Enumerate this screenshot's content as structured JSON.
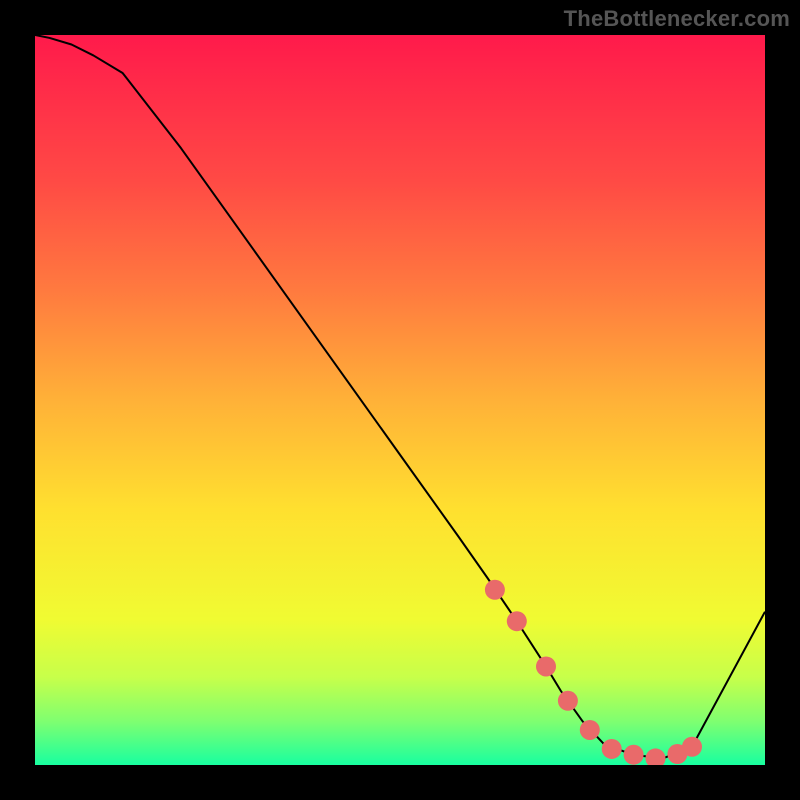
{
  "attribution": "TheBottlenecker.com",
  "chart_data": {
    "type": "line",
    "title": "",
    "xlabel": "",
    "ylabel": "",
    "xlim": [
      0,
      100
    ],
    "ylim": [
      0,
      100
    ],
    "axes_visible": false,
    "background": {
      "kind": "vertical-gradient",
      "stops": [
        {
          "pos": 0.0,
          "color": "#ff1a4b"
        },
        {
          "pos": 0.2,
          "color": "#ff4a45"
        },
        {
          "pos": 0.35,
          "color": "#ff7a3f"
        },
        {
          "pos": 0.5,
          "color": "#ffb138"
        },
        {
          "pos": 0.65,
          "color": "#ffe02f"
        },
        {
          "pos": 0.8,
          "color": "#f0fb32"
        },
        {
          "pos": 0.88,
          "color": "#c7ff4a"
        },
        {
          "pos": 0.94,
          "color": "#7fff70"
        },
        {
          "pos": 1.0,
          "color": "#18ffa0"
        }
      ]
    },
    "series": [
      {
        "name": "bottleneck-curve",
        "stroke": "#000000",
        "stroke_width": 2.0,
        "x": [
          0,
          2,
          5,
          8,
          12,
          20,
          30,
          40,
          50,
          58,
          62,
          66,
          70,
          72,
          75,
          78,
          82,
          86,
          90,
          100
        ],
        "y": [
          100,
          99.6,
          98.7,
          97.2,
          94.8,
          84.5,
          70.5,
          56.5,
          42.5,
          31.3,
          25.6,
          19.7,
          13.5,
          10.2,
          6.0,
          2.8,
          1.4,
          0.9,
          2.5,
          21.0
        ]
      },
      {
        "name": "highlight-dots",
        "kind": "scatter",
        "color": "#e96a6a",
        "radius": 10,
        "x": [
          63,
          66,
          70,
          73,
          76,
          79,
          82,
          85,
          88,
          90
        ],
        "y": [
          24.0,
          19.7,
          13.5,
          8.8,
          4.8,
          2.2,
          1.4,
          0.9,
          1.5,
          2.5
        ]
      }
    ]
  }
}
